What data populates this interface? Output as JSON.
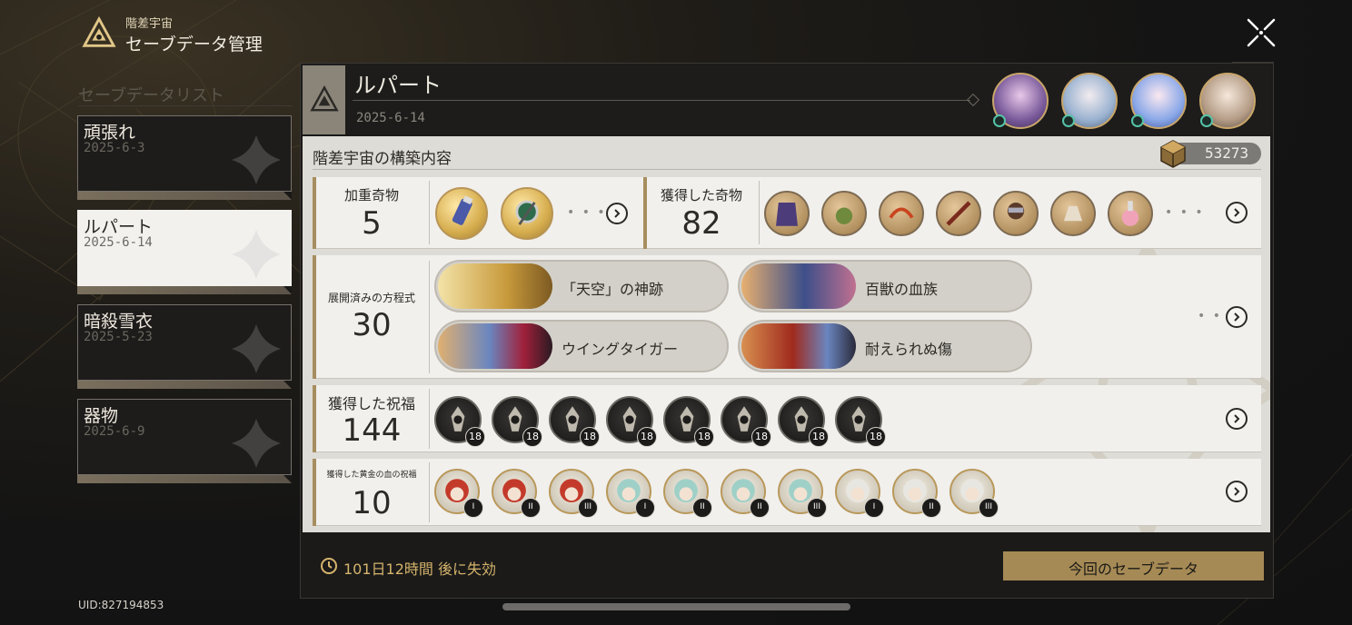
{
  "header": {
    "subtitle": "階差宇宙",
    "title": "セーブデータ管理"
  },
  "sidebar": {
    "list_title": "セーブデータリスト",
    "items": [
      {
        "name": "頑張れ",
        "date": "2025-6-3",
        "active": false
      },
      {
        "name": "ルパート",
        "date": "2025-6-14",
        "active": true
      },
      {
        "name": "暗殺雪衣",
        "date": "2025-5-23",
        "active": false
      },
      {
        "name": "器物",
        "date": "2025-6-9",
        "active": false
      }
    ],
    "uid": "UID:827194853"
  },
  "detail": {
    "name": "ルパート",
    "date": "2025-6-14",
    "section_title": "階差宇宙の構築内容",
    "points": "53273",
    "weighted_curios": {
      "label": "加重奇物",
      "count": "5",
      "more": "• • •"
    },
    "obtained_curios": {
      "label": "獲得した奇物",
      "count": "82",
      "more": "• • •"
    },
    "equations": {
      "label": "展開済みの方程式",
      "count": "30",
      "more": "• • •",
      "items": [
        {
          "name": "「天空」の神跡"
        },
        {
          "name": "百獣の血族"
        },
        {
          "name": "ウイングタイガー"
        },
        {
          "name": "耐えられぬ傷"
        }
      ]
    },
    "blessings": {
      "label": "獲得した祝福",
      "count": "144",
      "levels": [
        "18",
        "18",
        "18",
        "18",
        "18",
        "18",
        "18",
        "18"
      ]
    },
    "golden_blessings": {
      "label": "獲得した黄金の血の祝福",
      "count": "10",
      "tiers": [
        "I",
        "II",
        "III",
        "I",
        "II",
        "II",
        "III",
        "I",
        "II",
        "III"
      ]
    }
  },
  "footer": {
    "expire_text": "101日12時間 後に失効",
    "current_button": "今回のセーブデータ"
  },
  "colors": {
    "accent_gold": "#a68a55",
    "expire_text": "#d5b46b",
    "badge_teal": "#55c3a8"
  }
}
